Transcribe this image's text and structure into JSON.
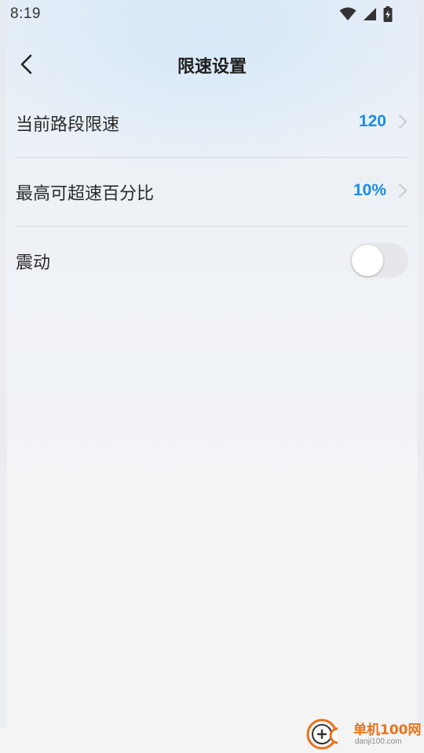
{
  "status_bar": {
    "time": "8:19",
    "icons": [
      "wifi-icon",
      "cellular-signal-icon",
      "battery-charging-icon"
    ]
  },
  "header": {
    "title": "限速设置",
    "back_icon": "chevron-left-icon"
  },
  "settings": [
    {
      "label": "当前路段限速",
      "value": "120",
      "type": "link"
    },
    {
      "label": "最高可超速百分比",
      "value": "10%",
      "type": "link"
    },
    {
      "label": "震动",
      "type": "toggle",
      "enabled": false
    }
  ],
  "colors": {
    "accent": "#1d8ce0",
    "divider": "#d6d8dc",
    "toggle_off_track": "#e6e7ea",
    "watermark": "#e8731c"
  },
  "watermark": {
    "brand": "单机100网",
    "domain": "danji100.com"
  }
}
